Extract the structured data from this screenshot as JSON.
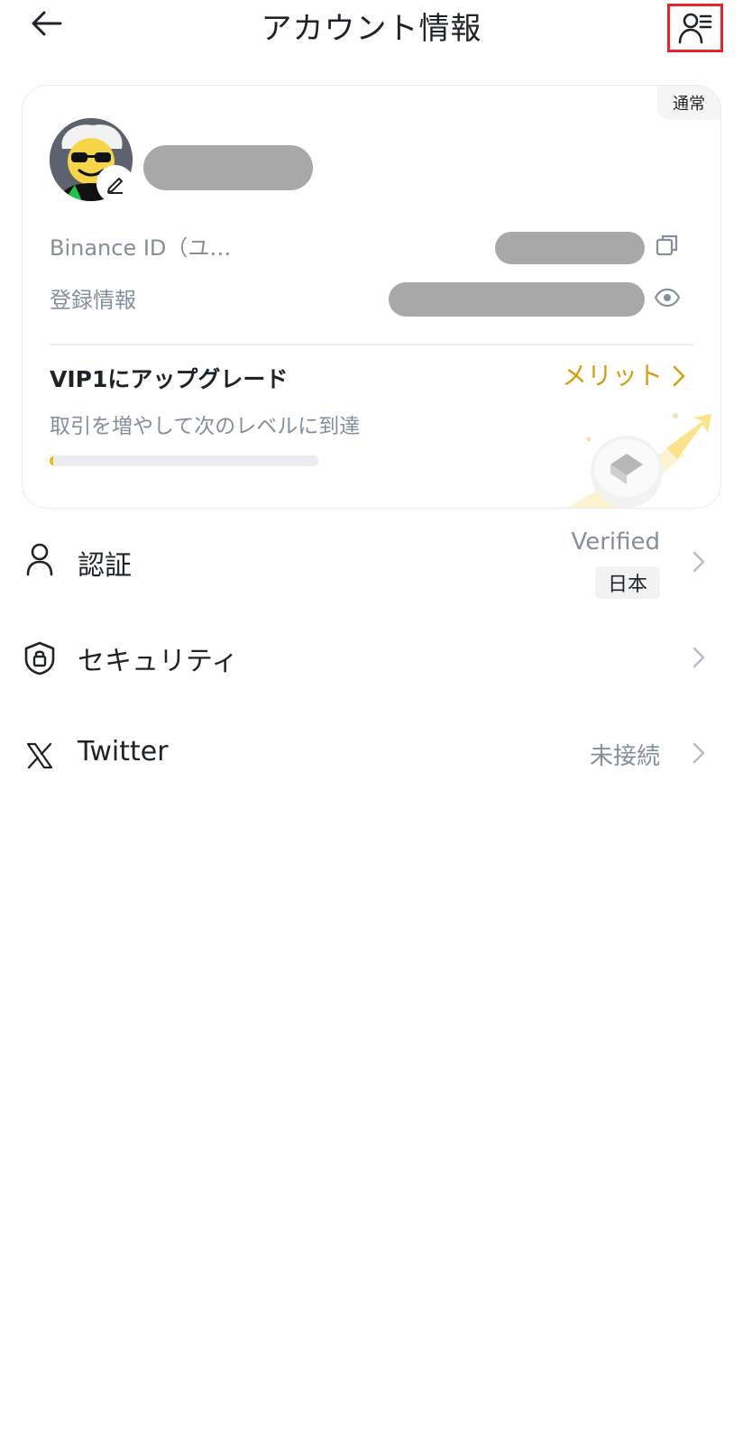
{
  "header": {
    "title": "アカウント情報",
    "back_icon": "arrow-left-icon",
    "profile_list_icon": "user-list-icon"
  },
  "card": {
    "badge": "通常",
    "avatar_icon": "avatar-sunglasses-icon",
    "edit_icon": "pencil-icon",
    "rows": [
      {
        "label": "Binance ID（ユ…",
        "icon": "copy-icon"
      },
      {
        "label": "登録情報",
        "icon": "eye-icon"
      }
    ],
    "vip": {
      "title": "VIP1にアップグレード",
      "link": "メリット",
      "subtitle": "取引を増やして次のレベルに到達",
      "progress": 0.015
    }
  },
  "menu": {
    "verification": {
      "label": "認証",
      "value": "Verified",
      "tag": "日本",
      "icon": "user-icon"
    },
    "security": {
      "label": "セキュリティ",
      "icon": "shield-lock-icon"
    },
    "twitter": {
      "label": "Twitter",
      "value": "未接続",
      "icon": "x-logo-icon"
    }
  },
  "colors": {
    "accent": "#f0b90b",
    "link": "#d89e12",
    "muted_text": "#848e9c",
    "highlight_border": "#e3262c"
  }
}
